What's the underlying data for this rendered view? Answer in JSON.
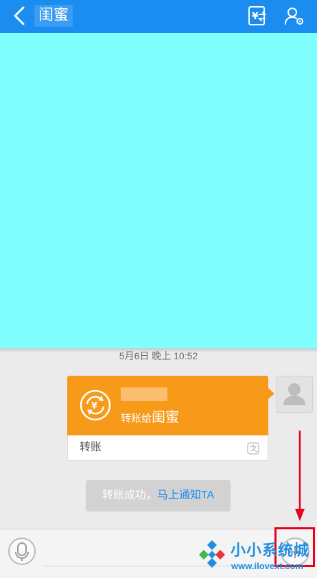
{
  "header": {
    "title": "闺蜜",
    "back_icon": "back-arrow-icon",
    "transfer_icon": "yuan-transfer-icon",
    "profile_icon": "user-settings-icon",
    "background_color": "#1b8cf0"
  },
  "panel": {
    "background_color": "#80ffff"
  },
  "chat": {
    "timestamp": "5月6日 晚上 10:52",
    "transfer_card": {
      "action_text": "转账给",
      "recipient": "闺蜜",
      "label": "转账",
      "icon": "transfer-cycle-icon",
      "provider_icon": "alipay-icon",
      "color": "#f79a1a"
    },
    "notice": {
      "text": "转账成功，",
      "link": "马上通知TA"
    }
  },
  "input_bar": {
    "voice_icon": "microphone-icon",
    "more_icon": "plus-icon",
    "placeholder": ""
  },
  "watermark": {
    "text": "小小系统城",
    "url": "www.ilovext.com"
  },
  "annotation": {
    "color": "#e8001c"
  }
}
